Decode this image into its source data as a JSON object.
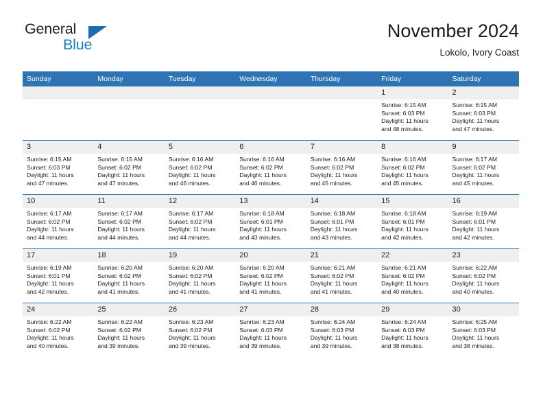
{
  "logo": {
    "line1": "General",
    "line2": "Blue",
    "triangle_icon": "triangle-icon",
    "color_dark": "#231f20",
    "color_blue": "#1b7ec9",
    "triangle_color": "#1b6cb5"
  },
  "header": {
    "title": "November 2024",
    "subtitle": "Lokolo, Ivory Coast"
  },
  "theme": {
    "header_blue": "#2e74b5",
    "daynum_band": "#efefef",
    "text": "#1a1a1a"
  },
  "calendar": {
    "weekday_headers": [
      "Sunday",
      "Monday",
      "Tuesday",
      "Wednesday",
      "Thursday",
      "Friday",
      "Saturday"
    ],
    "weeks": [
      [
        {
          "day": "",
          "empty": true,
          "sunrise": "",
          "sunset": "",
          "daylight_line1": "",
          "daylight_line2": ""
        },
        {
          "day": "",
          "empty": true,
          "sunrise": "",
          "sunset": "",
          "daylight_line1": "",
          "daylight_line2": ""
        },
        {
          "day": "",
          "empty": true,
          "sunrise": "",
          "sunset": "",
          "daylight_line1": "",
          "daylight_line2": ""
        },
        {
          "day": "",
          "empty": true,
          "sunrise": "",
          "sunset": "",
          "daylight_line1": "",
          "daylight_line2": ""
        },
        {
          "day": "",
          "empty": true,
          "sunrise": "",
          "sunset": "",
          "daylight_line1": "",
          "daylight_line2": ""
        },
        {
          "day": "1",
          "empty": false,
          "sunrise": "Sunrise: 6:15 AM",
          "sunset": "Sunset: 6:03 PM",
          "daylight_line1": "Daylight: 11 hours",
          "daylight_line2": "and 48 minutes."
        },
        {
          "day": "2",
          "empty": false,
          "sunrise": "Sunrise: 6:15 AM",
          "sunset": "Sunset: 6:03 PM",
          "daylight_line1": "Daylight: 11 hours",
          "daylight_line2": "and 47 minutes."
        }
      ],
      [
        {
          "day": "3",
          "empty": false,
          "sunrise": "Sunrise: 6:15 AM",
          "sunset": "Sunset: 6:03 PM",
          "daylight_line1": "Daylight: 11 hours",
          "daylight_line2": "and 47 minutes."
        },
        {
          "day": "4",
          "empty": false,
          "sunrise": "Sunrise: 6:15 AM",
          "sunset": "Sunset: 6:02 PM",
          "daylight_line1": "Daylight: 11 hours",
          "daylight_line2": "and 47 minutes."
        },
        {
          "day": "5",
          "empty": false,
          "sunrise": "Sunrise: 6:16 AM",
          "sunset": "Sunset: 6:02 PM",
          "daylight_line1": "Daylight: 11 hours",
          "daylight_line2": "and 46 minutes."
        },
        {
          "day": "6",
          "empty": false,
          "sunrise": "Sunrise: 6:16 AM",
          "sunset": "Sunset: 6:02 PM",
          "daylight_line1": "Daylight: 11 hours",
          "daylight_line2": "and 46 minutes."
        },
        {
          "day": "7",
          "empty": false,
          "sunrise": "Sunrise: 6:16 AM",
          "sunset": "Sunset: 6:02 PM",
          "daylight_line1": "Daylight: 11 hours",
          "daylight_line2": "and 45 minutes."
        },
        {
          "day": "8",
          "empty": false,
          "sunrise": "Sunrise: 6:16 AM",
          "sunset": "Sunset: 6:02 PM",
          "daylight_line1": "Daylight: 11 hours",
          "daylight_line2": "and 45 minutes."
        },
        {
          "day": "9",
          "empty": false,
          "sunrise": "Sunrise: 6:17 AM",
          "sunset": "Sunset: 6:02 PM",
          "daylight_line1": "Daylight: 11 hours",
          "daylight_line2": "and 45 minutes."
        }
      ],
      [
        {
          "day": "10",
          "empty": false,
          "sunrise": "Sunrise: 6:17 AM",
          "sunset": "Sunset: 6:02 PM",
          "daylight_line1": "Daylight: 11 hours",
          "daylight_line2": "and 44 minutes."
        },
        {
          "day": "11",
          "empty": false,
          "sunrise": "Sunrise: 6:17 AM",
          "sunset": "Sunset: 6:02 PM",
          "daylight_line1": "Daylight: 11 hours",
          "daylight_line2": "and 44 minutes."
        },
        {
          "day": "12",
          "empty": false,
          "sunrise": "Sunrise: 6:17 AM",
          "sunset": "Sunset: 6:02 PM",
          "daylight_line1": "Daylight: 11 hours",
          "daylight_line2": "and 44 minutes."
        },
        {
          "day": "13",
          "empty": false,
          "sunrise": "Sunrise: 6:18 AM",
          "sunset": "Sunset: 6:01 PM",
          "daylight_line1": "Daylight: 11 hours",
          "daylight_line2": "and 43 minutes."
        },
        {
          "day": "14",
          "empty": false,
          "sunrise": "Sunrise: 6:18 AM",
          "sunset": "Sunset: 6:01 PM",
          "daylight_line1": "Daylight: 11 hours",
          "daylight_line2": "and 43 minutes."
        },
        {
          "day": "15",
          "empty": false,
          "sunrise": "Sunrise: 6:18 AM",
          "sunset": "Sunset: 6:01 PM",
          "daylight_line1": "Daylight: 11 hours",
          "daylight_line2": "and 42 minutes."
        },
        {
          "day": "16",
          "empty": false,
          "sunrise": "Sunrise: 6:19 AM",
          "sunset": "Sunset: 6:01 PM",
          "daylight_line1": "Daylight: 11 hours",
          "daylight_line2": "and 42 minutes."
        }
      ],
      [
        {
          "day": "17",
          "empty": false,
          "sunrise": "Sunrise: 6:19 AM",
          "sunset": "Sunset: 6:01 PM",
          "daylight_line1": "Daylight: 11 hours",
          "daylight_line2": "and 42 minutes."
        },
        {
          "day": "18",
          "empty": false,
          "sunrise": "Sunrise: 6:20 AM",
          "sunset": "Sunset: 6:02 PM",
          "daylight_line1": "Daylight: 11 hours",
          "daylight_line2": "and 41 minutes."
        },
        {
          "day": "19",
          "empty": false,
          "sunrise": "Sunrise: 6:20 AM",
          "sunset": "Sunset: 6:02 PM",
          "daylight_line1": "Daylight: 11 hours",
          "daylight_line2": "and 41 minutes."
        },
        {
          "day": "20",
          "empty": false,
          "sunrise": "Sunrise: 6:20 AM",
          "sunset": "Sunset: 6:02 PM",
          "daylight_line1": "Daylight: 11 hours",
          "daylight_line2": "and 41 minutes."
        },
        {
          "day": "21",
          "empty": false,
          "sunrise": "Sunrise: 6:21 AM",
          "sunset": "Sunset: 6:02 PM",
          "daylight_line1": "Daylight: 11 hours",
          "daylight_line2": "and 41 minutes."
        },
        {
          "day": "22",
          "empty": false,
          "sunrise": "Sunrise: 6:21 AM",
          "sunset": "Sunset: 6:02 PM",
          "daylight_line1": "Daylight: 11 hours",
          "daylight_line2": "and 40 minutes."
        },
        {
          "day": "23",
          "empty": false,
          "sunrise": "Sunrise: 6:22 AM",
          "sunset": "Sunset: 6:02 PM",
          "daylight_line1": "Daylight: 11 hours",
          "daylight_line2": "and 40 minutes."
        }
      ],
      [
        {
          "day": "24",
          "empty": false,
          "sunrise": "Sunrise: 6:22 AM",
          "sunset": "Sunset: 6:02 PM",
          "daylight_line1": "Daylight: 11 hours",
          "daylight_line2": "and 40 minutes."
        },
        {
          "day": "25",
          "empty": false,
          "sunrise": "Sunrise: 6:22 AM",
          "sunset": "Sunset: 6:02 PM",
          "daylight_line1": "Daylight: 11 hours",
          "daylight_line2": "and 39 minutes."
        },
        {
          "day": "26",
          "empty": false,
          "sunrise": "Sunrise: 6:23 AM",
          "sunset": "Sunset: 6:02 PM",
          "daylight_line1": "Daylight: 11 hours",
          "daylight_line2": "and 39 minutes."
        },
        {
          "day": "27",
          "empty": false,
          "sunrise": "Sunrise: 6:23 AM",
          "sunset": "Sunset: 6:03 PM",
          "daylight_line1": "Daylight: 11 hours",
          "daylight_line2": "and 39 minutes."
        },
        {
          "day": "28",
          "empty": false,
          "sunrise": "Sunrise: 6:24 AM",
          "sunset": "Sunset: 6:03 PM",
          "daylight_line1": "Daylight: 11 hours",
          "daylight_line2": "and 39 minutes."
        },
        {
          "day": "29",
          "empty": false,
          "sunrise": "Sunrise: 6:24 AM",
          "sunset": "Sunset: 6:03 PM",
          "daylight_line1": "Daylight: 11 hours",
          "daylight_line2": "and 38 minutes."
        },
        {
          "day": "30",
          "empty": false,
          "sunrise": "Sunrise: 6:25 AM",
          "sunset": "Sunset: 6:03 PM",
          "daylight_line1": "Daylight: 11 hours",
          "daylight_line2": "and 38 minutes."
        }
      ]
    ]
  }
}
